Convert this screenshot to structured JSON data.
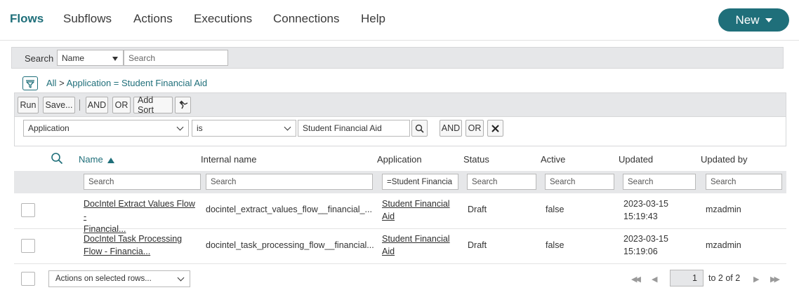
{
  "nav": {
    "tabs": [
      "Flows",
      "Subflows",
      "Actions",
      "Executions",
      "Connections",
      "Help"
    ],
    "new_label": "New"
  },
  "search": {
    "label": "Search",
    "field": "Name",
    "placeholder": "Search"
  },
  "breadcrumb": {
    "all": "All",
    "separator": ">",
    "filter": "Application = Student Financial Aid"
  },
  "condition": {
    "toolbar": [
      "Run",
      "Save...",
      "AND",
      "OR",
      "Add Sort"
    ],
    "field": "Application",
    "operator": "is",
    "value": "Student Financial Aid",
    "and_label": "AND",
    "or_label": "OR"
  },
  "table": {
    "columns": {
      "name": "Name",
      "internal_name": "Internal name",
      "application": "Application",
      "status": "Status",
      "active": "Active",
      "updated": "Updated",
      "updated_by": "Updated by"
    },
    "filters": {
      "name": "Search",
      "internal_name": "Search",
      "application": "=Student Financia",
      "status": "Search",
      "active": "Search",
      "updated": "Search",
      "updated_by": "Search"
    },
    "rows": [
      {
        "name_line1": "DocIntel Extract Values Flow -",
        "name_line2": "Financial...",
        "internal_name": "docintel_extract_values_flow__financial_...",
        "app_line1": "Student Financial",
        "app_line2": "Aid",
        "status": "Draft",
        "active": "false",
        "updated_date": "2023-03-15",
        "updated_time": "15:19:43",
        "updated_by": "mzadmin"
      },
      {
        "name_line1": "DocIntel Task Processing",
        "name_line2": "Flow - Financia...",
        "internal_name": "docintel_task_processing_flow__financial...",
        "app_line1": "Student Financial",
        "app_line2": "Aid",
        "status": "Draft",
        "active": "false",
        "updated_date": "2023-03-15",
        "updated_time": "15:19:06",
        "updated_by": "mzadmin"
      }
    ]
  },
  "footer": {
    "actions_placeholder": "Actions on selected rows...",
    "page": "1",
    "of_text": "to 2 of 2"
  },
  "colors": {
    "accent": "#1f6f7a",
    "toolbar_bg": "#e6e7e9"
  }
}
